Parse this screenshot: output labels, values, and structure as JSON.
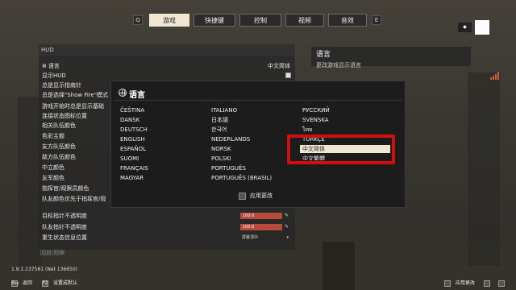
{
  "topbar": {
    "key_left": "Q",
    "key_right": "E",
    "tabs": [
      {
        "label": "游戏",
        "active": true
      },
      {
        "label": "快捷键",
        "active": false
      },
      {
        "label": "控制",
        "active": false
      },
      {
        "label": "视频",
        "active": false
      },
      {
        "label": "音效",
        "active": false
      }
    ]
  },
  "left_panel": {
    "section_header": "HUD",
    "rows": [
      {
        "label": "语言",
        "value": "中文简体"
      },
      {
        "label": "显示HUD"
      },
      {
        "label": "总是显示指南针"
      },
      {
        "label": "总是选择\"Show Fire\"模式"
      },
      {
        "label": "游戏开始时总是显示基础"
      },
      {
        "label": "连接状态图标位置"
      },
      {
        "label": "相关队伍颜色"
      },
      {
        "label": "色彩主题"
      },
      {
        "label": "友方队伍颜色"
      },
      {
        "label": "敌方队伍颜色"
      },
      {
        "label": "中立颜色"
      },
      {
        "label": "友军颜色"
      },
      {
        "label": "指挥官/观察员颜色"
      },
      {
        "label": "队友颜色优先于指挥官/观"
      },
      {
        "label": "目标指针不透明度",
        "value": "100.0"
      },
      {
        "label": "队友指针不透明度",
        "value": "100.0"
      },
      {
        "label": "重生状态信息位置",
        "value": "屏幕顶中"
      }
    ],
    "dim_row": "回放/观察"
  },
  "right_panel": {
    "title": "语言",
    "description": "更改游戏显示语言"
  },
  "modal": {
    "title": "语言",
    "col1": [
      "ČEŠTINA",
      "DANSK",
      "DEUTSCH",
      "ENGLISH",
      "ESPAÑOL",
      "SUOMI",
      "FRANÇAIS",
      "MAGYAR"
    ],
    "col2": [
      "ITALIANO",
      "日本語",
      "한국어",
      "NEDERLANDS",
      "NORSK",
      "POLSKI",
      "PORTUGUÊS",
      "PORTUGUÊS (BRASIL)"
    ],
    "col3": [
      "РУССКИЙ",
      "SVENSKA",
      "ไทย",
      "TÜRKÇE",
      "中文简体",
      "中文繁體"
    ],
    "selected": "中文简体",
    "apply_label": "应用更改"
  },
  "footer": {
    "version": "1.9.1.137561 (Net 136650)",
    "back_key": "Esc",
    "back_label": "返回",
    "reset_key": "F2",
    "reset_label": "设置成默认",
    "apply_label": "应用更改"
  },
  "colors": {
    "accent_tab": "#f0e6d2",
    "highlight_box": "#d10f0f",
    "slider": "#b84a3c"
  }
}
